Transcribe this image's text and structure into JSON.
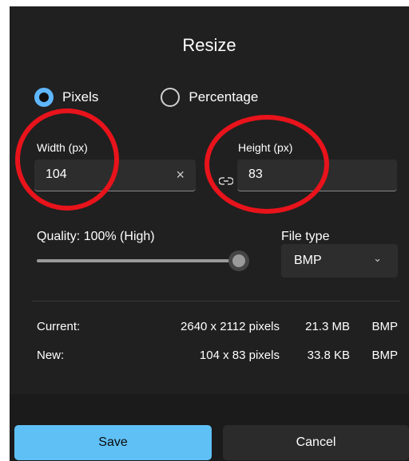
{
  "dialog": {
    "title": "Resize",
    "mode_options": {
      "pixels": "Pixels",
      "percentage": "Percentage"
    },
    "selected_mode": "pixels",
    "width": {
      "label": "Width  (px)",
      "value": "104",
      "clear_icon": "×"
    },
    "height": {
      "label": "Height  (px)",
      "value": "83"
    },
    "quality": {
      "label": "Quality: 100% (High)",
      "value_percent": 100
    },
    "file_type": {
      "label": "File type",
      "value": "BMP",
      "chevron": "⌄"
    },
    "info": {
      "current": {
        "label": "Current:",
        "dimensions": "2640 x 2112 pixels",
        "size": "21.3 MB",
        "type": "BMP"
      },
      "new": {
        "label": "New:",
        "dimensions": "104 x 83 pixels",
        "size": "33.8 KB",
        "type": "BMP"
      }
    },
    "buttons": {
      "save": "Save",
      "cancel": "Cancel"
    },
    "colors": {
      "accent": "#5fc0f5",
      "background": "#202020",
      "annotation": "#e8131b"
    }
  }
}
